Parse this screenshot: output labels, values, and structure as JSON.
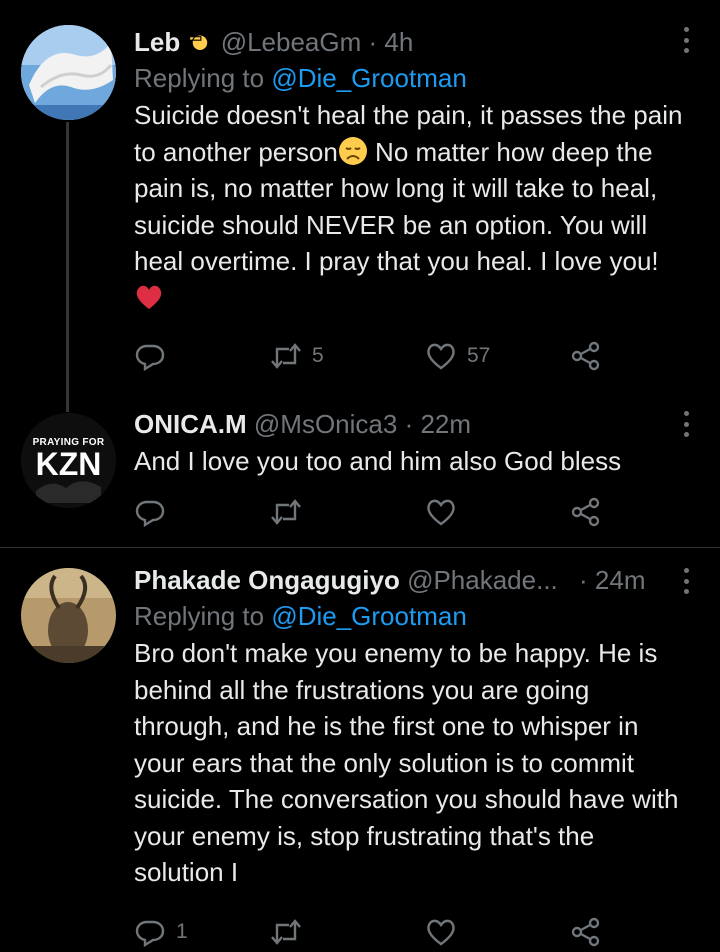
{
  "tweets": [
    {
      "name": "Leb",
      "name_emoji": "pointing-hand-emoji",
      "handle": "@LebeaGm",
      "time": "· 4h",
      "replying_prefix": "Replying to ",
      "replying_to": "@Die_Grootman",
      "text_1": "Suicide doesn't heal the pain, it passes the pain to another person",
      "text_1_emoji": "disappointed-face-emoji",
      "text_2": " No matter how deep the pain is, no matter how long it will take to heal, suicide should NEVER be an option. You will heal overtime. I pray that you heal. I love you! ",
      "text_2_emoji": "red-heart-emoji",
      "retweets": "5",
      "likes": "57",
      "accent_color": "#1d9bf0"
    },
    {
      "name": "ONICA.M",
      "handle": "@MsOnica3",
      "time": "· 22m",
      "avatar_top_text": "PRAYING FOR",
      "avatar_main_text": "KZN",
      "text": "And I love you too and him also God bless"
    },
    {
      "name": "Phakade Ongagugiyo",
      "handle": "@Phakade...",
      "time": "· 24m",
      "replying_prefix": "Replying to ",
      "replying_to": "@Die_Grootman",
      "text": "Bro don't make you enemy to be happy. He is behind all the frustrations you are going through, and he is the first one to whisper in your ears that the only solution is to commit suicide. The conversation you should have with your enemy is, stop frustrating that's the solution I",
      "replies": "1"
    }
  ],
  "icons": {
    "reply": "reply-icon",
    "retweet": "retweet-icon",
    "like": "heart-icon",
    "share": "share-icon",
    "more": "more-icon"
  },
  "colors": {
    "background": "#000000",
    "text": "#e7e9ea",
    "secondary": "#71767b",
    "mention": "#1d9bf0",
    "divider": "#2f3336"
  }
}
